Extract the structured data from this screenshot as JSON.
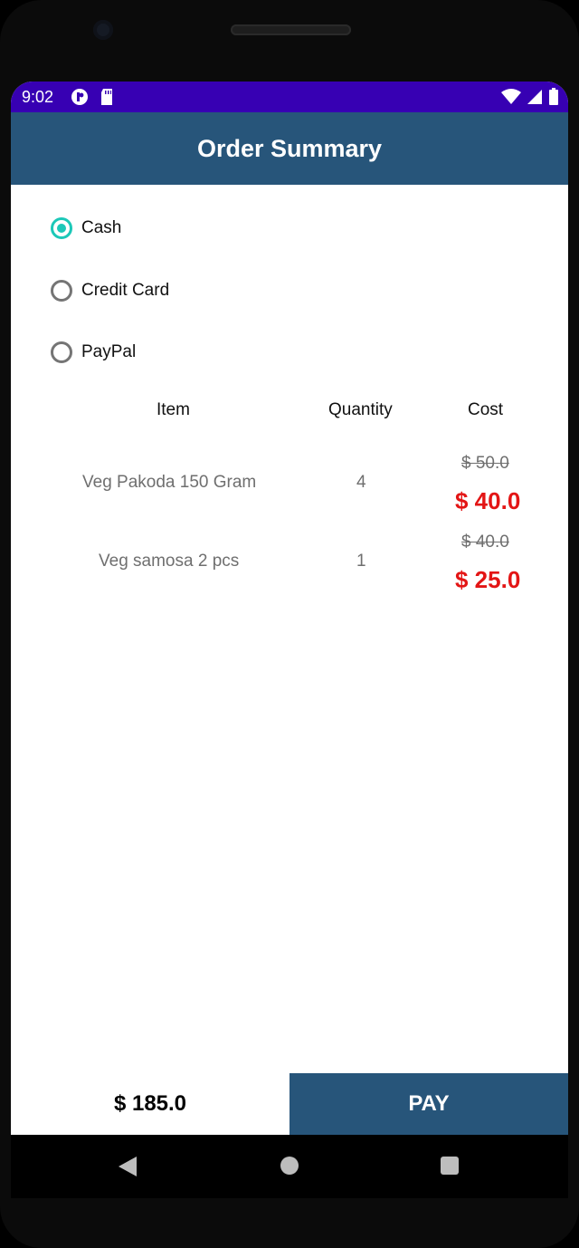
{
  "status": {
    "time": "9:02"
  },
  "app_bar": {
    "title": "Order Summary"
  },
  "payment_options": [
    {
      "label": "Cash",
      "selected": true
    },
    {
      "label": "Credit Card",
      "selected": false
    },
    {
      "label": "PayPal",
      "selected": false
    }
  ],
  "table": {
    "headers": {
      "item": "Item",
      "quantity": "Quantity",
      "cost": "Cost"
    },
    "rows": [
      {
        "item": "Veg Pakoda 150 Gram",
        "quantity": "4",
        "old_cost": "$ 50.0",
        "new_cost": "$ 40.0"
      },
      {
        "item": "Veg samosa 2 pcs",
        "quantity": "1",
        "old_cost": "$ 40.0",
        "new_cost": "$ 25.0"
      }
    ]
  },
  "footer": {
    "total": "$ 185.0",
    "pay_label": "PAY"
  },
  "colors": {
    "status_bar": "#3700b3",
    "app_bar": "#27557a",
    "radio_checked": "#1cc8b8",
    "price_red": "#e31515"
  }
}
